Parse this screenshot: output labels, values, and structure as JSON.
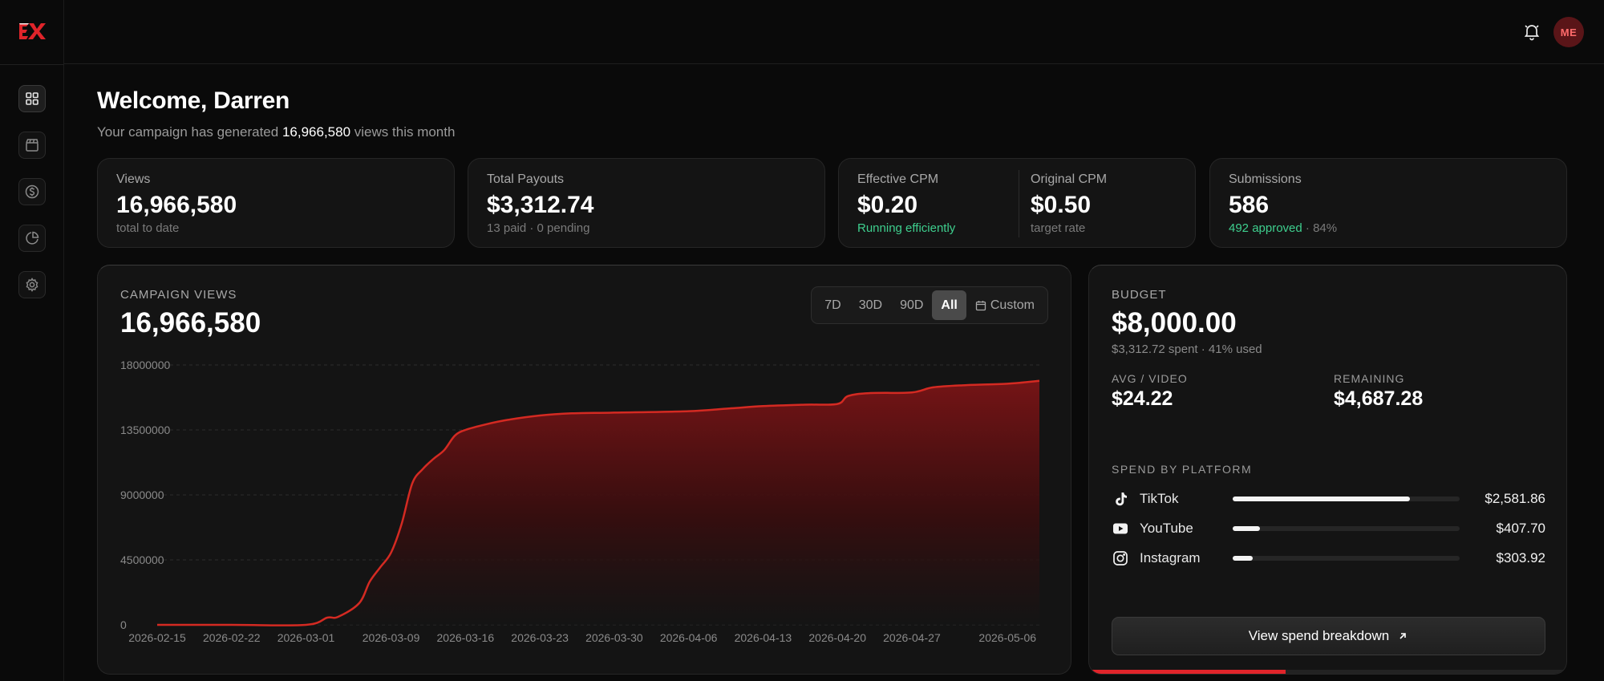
{
  "brand": {
    "logo_text": "EX",
    "accent": "#e0242a"
  },
  "sidebar": {
    "items": [
      {
        "name": "dashboard",
        "icon": "grid-icon",
        "active": true
      },
      {
        "name": "campaigns",
        "icon": "clapperboard-icon",
        "active": false
      },
      {
        "name": "payouts",
        "icon": "dollar-circle-icon",
        "active": false
      },
      {
        "name": "analytics",
        "icon": "pie-chart-icon",
        "active": false
      },
      {
        "name": "settings",
        "icon": "gear-icon",
        "active": false
      }
    ]
  },
  "header": {
    "avatar_initials": "ME",
    "notification_icon": "bell-icon"
  },
  "welcome": {
    "title": "Welcome, Darren",
    "sub_prefix": "Your campaign has generated",
    "sub_value": "16,966,580",
    "sub_suffix": "views this month"
  },
  "stats": {
    "views": {
      "label": "Views",
      "value": "16,966,580",
      "sub": "total to date"
    },
    "payouts": {
      "label": "Total Payouts",
      "value": "$3,312.74",
      "sub": "13 paid · 0 pending"
    },
    "effective_cpm": {
      "label": "Effective CPM",
      "value": "$0.20",
      "sub": "Running efficiently"
    },
    "original_cpm": {
      "label": "Original CPM",
      "value": "$0.50",
      "sub": "target rate"
    },
    "submissions": {
      "label": "Submissions",
      "value": "586",
      "sub_green": "492 approved",
      "sub_rest": "· 84%"
    }
  },
  "campaign_views": {
    "eyebrow": "CAMPAIGN VIEWS",
    "total": "16,966,580",
    "ranges": [
      "7D",
      "30D",
      "90D",
      "All",
      "Custom"
    ],
    "active_range": "All"
  },
  "chart_data": {
    "type": "area",
    "title": "CAMPAIGN VIEWS",
    "xlabel": "",
    "ylabel": "",
    "ylim": [
      0,
      18000000
    ],
    "yticks": [
      0,
      4500000,
      9000000,
      13500000,
      18000000
    ],
    "ytick_labels": [
      "0",
      "4500000",
      "9000000",
      "13500000",
      "18000000"
    ],
    "xtick_labels": [
      "2026-02-15",
      "2026-02-22",
      "2026-03-01",
      "2026-03-09",
      "2026-03-16",
      "2026-03-23",
      "2026-03-30",
      "2026-04-06",
      "2026-04-13",
      "2026-04-20",
      "2026-04-27",
      "2026-05-06"
    ],
    "grid": true,
    "color": "#d42a22",
    "series": [
      {
        "x": [
          "2026-02-15",
          "2026-02-22",
          "2026-03-01",
          "2026-03-03",
          "2026-03-04",
          "2026-03-06",
          "2026-03-07",
          "2026-03-08",
          "2026-03-09",
          "2026-03-10",
          "2026-03-11",
          "2026-03-12",
          "2026-03-13",
          "2026-03-14",
          "2026-03-15",
          "2026-03-16",
          "2026-03-18",
          "2026-03-20",
          "2026-03-23",
          "2026-03-26",
          "2026-03-30",
          "2026-04-06",
          "2026-04-10",
          "2026-04-13",
          "2026-04-17",
          "2026-04-20",
          "2026-04-21",
          "2026-04-23",
          "2026-04-27",
          "2026-04-29",
          "2026-05-02",
          "2026-05-06",
          "2026-05-09"
        ],
        "y": [
          0,
          0,
          0,
          500000,
          550000,
          1500000,
          3000000,
          4000000,
          5000000,
          7000000,
          9800000,
          10800000,
          11500000,
          12100000,
          13100000,
          13500000,
          13900000,
          14200000,
          14500000,
          14650000,
          14700000,
          14800000,
          15000000,
          15150000,
          15250000,
          15300000,
          15850000,
          16050000,
          16100000,
          16450000,
          16600000,
          16700000,
          16900000
        ]
      }
    ]
  },
  "budget": {
    "eyebrow": "BUDGET",
    "total": "$8,000.00",
    "sub": "$3,312.72 spent · 41% used",
    "spent_fraction": 0.41,
    "avg_label": "AVG / VIDEO",
    "avg_value": "$24.22",
    "remaining_label": "REMAINING",
    "remaining_value": "$4,687.28",
    "platform_title": "SPEND BY PLATFORM",
    "platforms": [
      {
        "name": "TikTok",
        "icon": "tiktok-icon",
        "amount": "$2,581.86",
        "fraction": 0.78
      },
      {
        "name": "YouTube",
        "icon": "youtube-icon",
        "amount": "$407.70",
        "fraction": 0.12
      },
      {
        "name": "Instagram",
        "icon": "instagram-icon",
        "amount": "$303.92",
        "fraction": 0.09
      }
    ],
    "button_label": "View spend breakdown"
  }
}
